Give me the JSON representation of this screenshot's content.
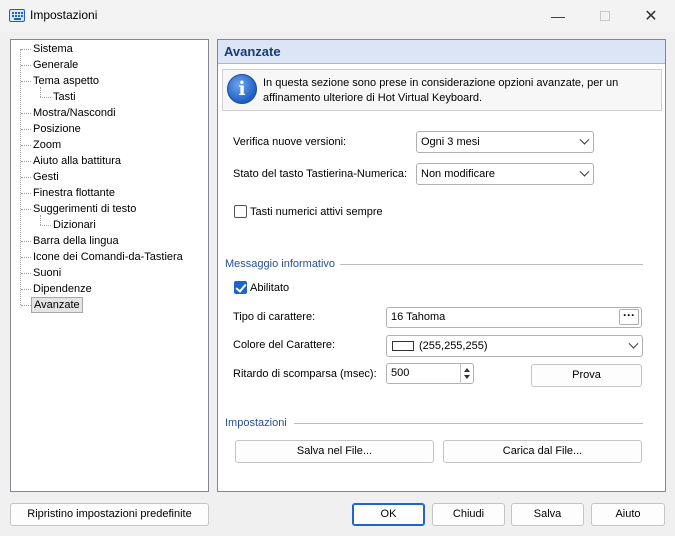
{
  "window": {
    "title": "Impostazioni"
  },
  "tree": {
    "items": [
      {
        "label": "Sistema",
        "level": 0
      },
      {
        "label": "Generale",
        "level": 0
      },
      {
        "label": "Tema aspetto",
        "level": 0
      },
      {
        "label": "Tasti",
        "level": 1
      },
      {
        "label": "Mostra/Nascondi",
        "level": 0
      },
      {
        "label": "Posizione",
        "level": 0
      },
      {
        "label": "Zoom",
        "level": 0
      },
      {
        "label": "Aiuto alla battitura",
        "level": 0
      },
      {
        "label": "Gesti",
        "level": 0
      },
      {
        "label": "Finestra flottante",
        "level": 0
      },
      {
        "label": "Suggerimenti di testo",
        "level": 0
      },
      {
        "label": "Dizionari",
        "level": 1
      },
      {
        "label": "Barra della lingua",
        "level": 0
      },
      {
        "label": "Icone dei Comandi-da-Tastiera",
        "level": 0
      },
      {
        "label": "Suoni",
        "level": 0
      },
      {
        "label": "Dipendenze",
        "level": 0
      },
      {
        "label": "Avanzate",
        "level": 0,
        "selected": true
      }
    ]
  },
  "panel": {
    "title": "Avanzate",
    "info_text": "In questa sezione sono prese in considerazione opzioni avanzate, per un affinamento ulteriore di Hot Virtual Keyboard.",
    "check_updates_label": "Verifica nuove versioni:",
    "check_updates_value": "Ogni 3 mesi",
    "numpad_state_label": "Stato del tasto Tastierina-Numerica:",
    "numpad_state_value": "Non modificare",
    "numeric_keys_label": "Tasti numerici attivi sempre",
    "numeric_keys_checked": false,
    "info_group": {
      "title": "Messaggio informativo",
      "enabled_label": "Abilitato",
      "enabled_checked": true,
      "font_label": "Tipo di carattere:",
      "font_value": "16 Tahoma",
      "color_label": "Colore del Carattere:",
      "color_value": "(255,255,255)",
      "color_hex": "#ffffff",
      "delay_label": "Ritardo di scomparsa (msec):",
      "delay_value": "500",
      "test_button": "Prova"
    },
    "settings_group": {
      "title": "Impostazioni",
      "save_button": "Salva nel File...",
      "load_button": "Carica dal File..."
    }
  },
  "footer": {
    "reset_button": "Ripristino impostazioni predefinite",
    "ok_button": "OK",
    "close_button": "Chiudi",
    "save_button": "Salva",
    "help_button": "Aiuto"
  }
}
